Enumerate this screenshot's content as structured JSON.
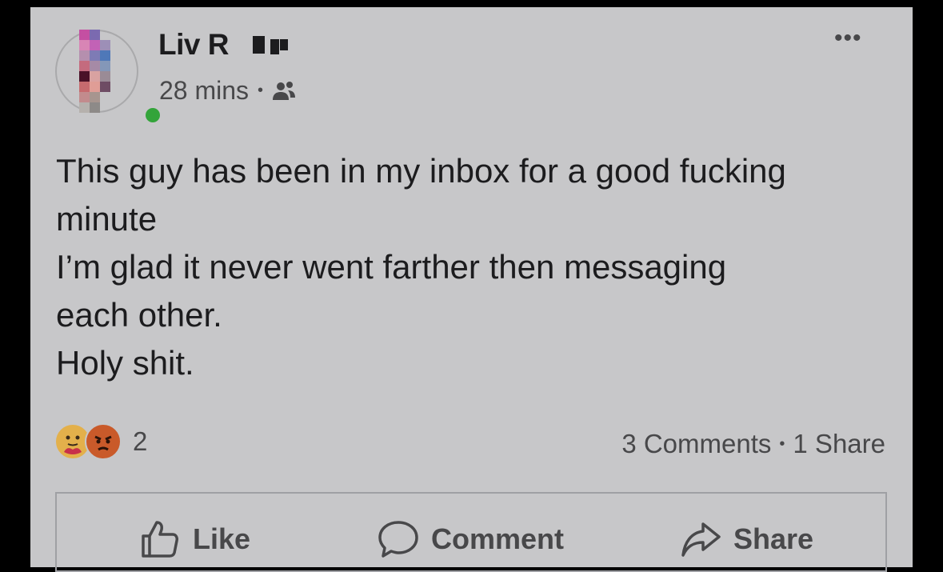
{
  "post": {
    "author_name": "Liv R",
    "time": "28 mins",
    "meta_separator": "•",
    "audience_icon": "friends-icon",
    "more_icon": "•••",
    "body_lines": [
      "This guy has been in my inbox for a good fucking",
      "minute",
      "I’m glad it never went farther then messaging",
      "each other.",
      "Holy shit."
    ],
    "reactions": {
      "icons": [
        "care-reaction-icon",
        "angry-reaction-icon"
      ],
      "count": "2"
    },
    "stats": {
      "comments": "3 Comments",
      "separator": "•",
      "shares": "1 Share"
    },
    "actions": {
      "like_label": "Like",
      "comment_label": "Comment",
      "share_label": "Share"
    }
  },
  "colors": {
    "card_background": "#c7c7c9",
    "text_primary": "#1c1c1e",
    "text_secondary": "#48484a",
    "online_dot": "#33a43a",
    "page_background": "#000000"
  }
}
